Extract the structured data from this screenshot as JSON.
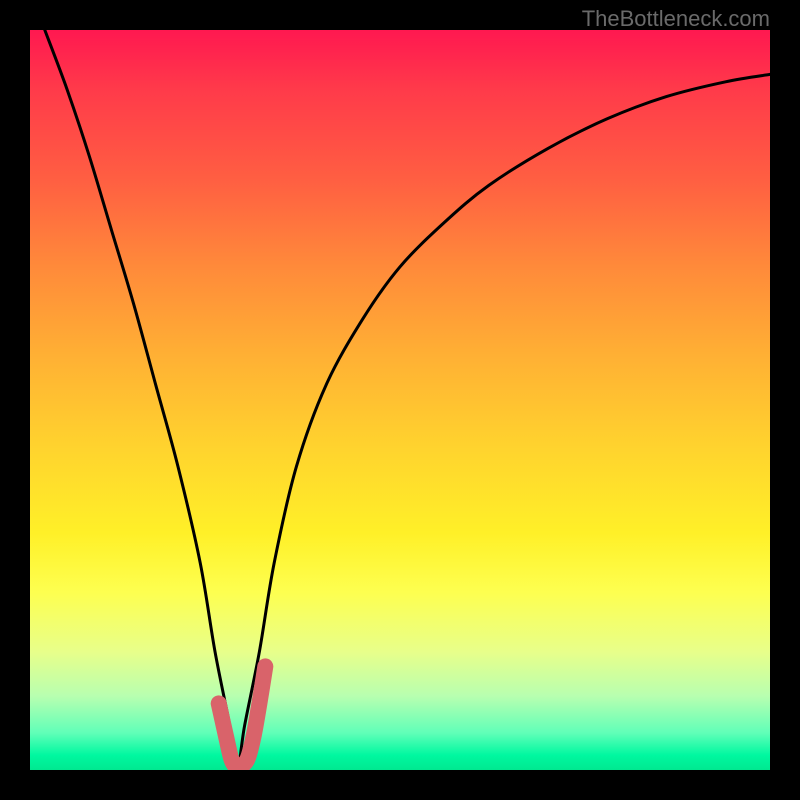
{
  "watermark": "TheBottleneck.com",
  "chart_data": {
    "type": "line",
    "title": "",
    "xlabel": "",
    "ylabel": "",
    "xlim": [
      0,
      100
    ],
    "ylim": [
      0,
      100
    ],
    "notch_x": 28,
    "series": [
      {
        "name": "black-curve",
        "color": "#000000",
        "x": [
          2,
          5,
          8,
          11,
          14,
          17,
          20,
          23,
          25,
          27,
          28,
          29,
          31,
          33,
          36,
          40,
          45,
          50,
          56,
          62,
          70,
          78,
          86,
          94,
          100
        ],
        "y": [
          100,
          92,
          83,
          73,
          63,
          52,
          41,
          28,
          16,
          6,
          0,
          6,
          16,
          28,
          41,
          52,
          61,
          68,
          74,
          79,
          84,
          88,
          91,
          93,
          94
        ]
      },
      {
        "name": "red-highlight",
        "color": "#d9636a",
        "thick": true,
        "x": [
          25.5,
          26.5,
          27.2,
          27.8,
          28.5,
          29.4,
          30.2,
          31,
          31.8
        ],
        "y": [
          9,
          4.5,
          1.5,
          0.5,
          0.5,
          1.5,
          4.5,
          9,
          14
        ]
      }
    ]
  }
}
